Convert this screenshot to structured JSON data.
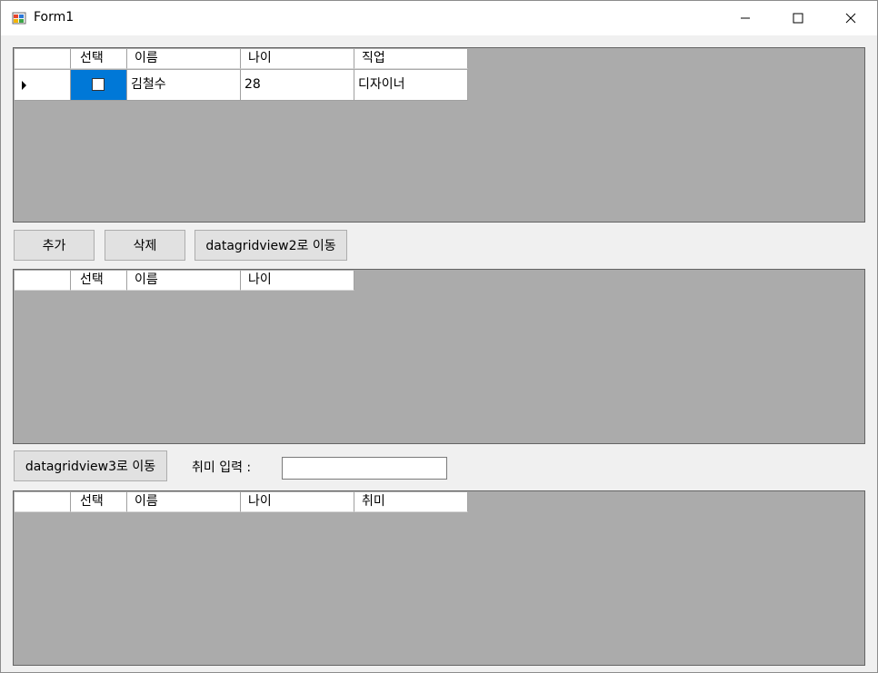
{
  "window": {
    "title": "Form1",
    "controls": {
      "minimize": "minimize-icon",
      "maximize": "maximize-icon",
      "close": "close-icon"
    }
  },
  "grid1": {
    "columns": [
      "",
      "선택",
      "이름",
      "나이",
      "직업"
    ],
    "rows": [
      {
        "selected": false,
        "name": "김철수",
        "age": "28",
        "job": "디자이너"
      }
    ]
  },
  "buttons": {
    "add": "추가",
    "delete": "삭제",
    "move_to_grid2": "datagridview2로 이동",
    "move_to_grid3": "datagridview3로 이동"
  },
  "grid2": {
    "columns": [
      "",
      "선택",
      "이름",
      "나이"
    ]
  },
  "hobby": {
    "label": "취미 입력 :",
    "value": ""
  },
  "grid3": {
    "columns": [
      "",
      "선택",
      "이름",
      "나이",
      "취미"
    ]
  },
  "colors": {
    "grid_background": "#ababab",
    "selection": "#0078d7",
    "button_face": "#e1e1e1"
  }
}
